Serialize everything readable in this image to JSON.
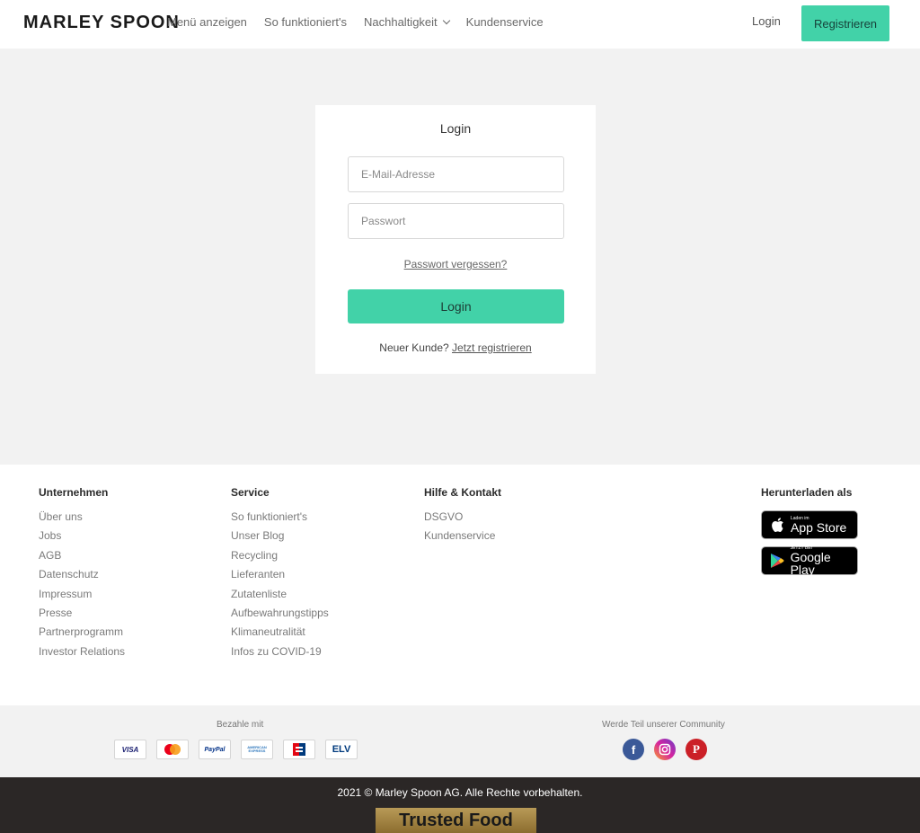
{
  "header": {
    "logo": "MARLEY SPOON",
    "nav": [
      "Menü anzeigen",
      "So funktioniert's",
      "Nachhaltigkeit",
      "Kundenservice"
    ],
    "login": "Login",
    "register": "Registrieren"
  },
  "login_card": {
    "title": "Login",
    "email_placeholder": "E-Mail-Adresse",
    "password_placeholder": "Passwort",
    "forgot": "Passwort vergessen?",
    "login_button": "Login",
    "new_customer": "Neuer Kunde?",
    "register_link": "Jetzt registrieren"
  },
  "footer": {
    "columns": [
      {
        "title": "Unternehmen",
        "links": [
          "Über uns",
          "Jobs",
          "AGB",
          "Datenschutz",
          "Impressum",
          "Presse",
          "Partnerprogramm",
          "Investor Relations"
        ]
      },
      {
        "title": "Service",
        "links": [
          "So funktioniert's",
          "Unser Blog",
          "Recycling",
          "Lieferanten",
          "Zutatenliste",
          "Aufbewahrungstipps",
          "Klimaneutralität",
          "Infos zu COVID-19"
        ]
      },
      {
        "title": "Hilfe & Kontakt",
        "links": [
          "DSGVO",
          "Kundenservice"
        ]
      }
    ],
    "download": {
      "title": "Herunterladen als",
      "appstore_small": "Laden im",
      "appstore_big": "App Store",
      "gplay_small": "JETZT BEI",
      "gplay_big": "Google Play"
    }
  },
  "strip": {
    "pay_title": "Bezahle mit",
    "payment_methods": [
      "VISA",
      "",
      "PayPal",
      "AMERICAN EXPRESS",
      "",
      "ELV"
    ],
    "community_title": "Werde Teil unserer Community"
  },
  "copyright": {
    "text": "2021 © Marley Spoon AG. Alle Rechte vorbehalten.",
    "badge": "Trusted Food"
  },
  "colors": {
    "accent": "#42d2a8",
    "facebook": "#3b5998",
    "instagram": "#c13584",
    "pinterest": "#cb2027",
    "footer_dark": "#2b2726"
  }
}
